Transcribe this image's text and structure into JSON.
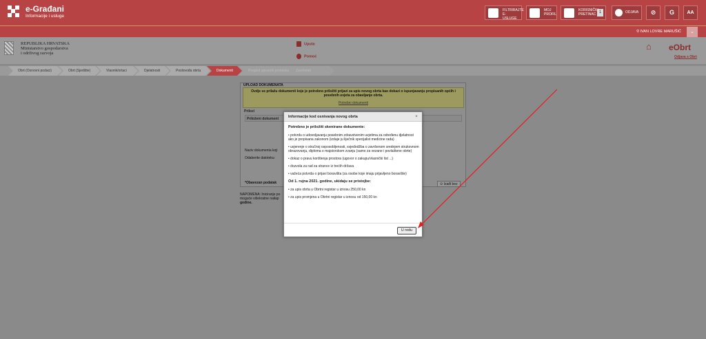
{
  "header": {
    "app_title": "e-Građani",
    "app_subtitle": "Informacije i usluge",
    "buttons": [
      {
        "label": "FILTRIRAJTE\nE-USLUGE",
        "icon": "filter-icon"
      },
      {
        "label": "MOJ\nPROFIL",
        "icon": "profile-icon"
      },
      {
        "label": "KORISNIČKI\nPRETINAC",
        "icon": "inbox-icon",
        "count": "1"
      },
      {
        "label": "ODJAVA",
        "icon": "logout-icon"
      }
    ],
    "icon_buttons": [
      "eye-slash-icon",
      "font-icon",
      "text-size-icon"
    ],
    "username": "IVAN LOVRE MARUŠIĆ"
  },
  "site": {
    "ministry_line1": "REPUBLIKA HRVATSKA",
    "ministry_line2": "Ministarstvo gospodarstva",
    "ministry_line3": "i održivog razvoja",
    "uputa": "Uputa",
    "pomoc": "Pomoć",
    "service": "eObrt",
    "logout": "Odjava s Obrt"
  },
  "breadcrumbs": [
    {
      "label": "Obrt (Osnovni podaci)",
      "state": "done"
    },
    {
      "label": "Obrt (Sjedište)",
      "state": "done"
    },
    {
      "label": "Vlasnik/ortaci",
      "state": "done"
    },
    {
      "label": "Djelatnosti",
      "state": "done"
    },
    {
      "label": "Poslovođa obrta",
      "state": "done"
    },
    {
      "label": "Dokumenti",
      "state": "active"
    },
    {
      "label": "Pregled upisanih podataka",
      "state": "future"
    },
    {
      "label": "Završetak",
      "state": "future"
    }
  ],
  "panel": {
    "title": "UPLOAD DOKUMENATA",
    "notice": "Ovdje se prilažu dokumenti koje je potrebno priložiti prijavi za upis novog obrta kao dokazi o ispunjavanju propisanih općih i posebnih uvjeta za obavljanje obrta.",
    "notice_link": "Potrebni dokumenti",
    "prilozi": "Prilozi",
    "col_header": "Priloženi dokument",
    "naziv_label": "Naziv dokumenta koji",
    "datoteka_label": "Odaberite datoteku:",
    "required": "*Obavezan podatak",
    "btn_close": "Izađi bez",
    "napomena": "NAPOMENA: Iniciranje po",
    "napomena2": "moguće višekratne naiłap",
    "godine": "godine."
  },
  "modal": {
    "title": "Informacije kod osnivanja novog obrta",
    "heading1": "Potrebno je priložiti skenirane dokumente:",
    "items": [
      "• potvrdu o udovoljavanju posebnim zdravstvenim uvjetima za određenu djelatnost ako je propisana zakonom (izdaje ju liječnik specijalist medicine rada)",
      "• uvjerenje o stručnoj osposobljenosti, svjedodžba o završenom srednjem strukovnom obrazovanju, diploma o majstorskom zvanju (samo za vezane i povlaštene obrte)",
      "• dokaz o pravu korištenja prostora (ugovor o zakupu/vlasnički list ...)",
      "• dozvola za rad za strance iz trećih država",
      "• važeća potvrda o prijavi boravišta (za osobe koje imaju prijavljeno boravište)"
    ],
    "heading2": "Od 1. rujna 2021. godine, ukidaju se pristojbe:",
    "items2": [
      "• za upis obrta u Obrtni registar u iznosu 250,00 kn",
      "• za upis promjena u Obrtni registar u iznosu od 150,00 kn"
    ],
    "ok": "U redu"
  },
  "colors": {
    "brand": "#b84345",
    "annotation_arrow": "#e02020"
  }
}
